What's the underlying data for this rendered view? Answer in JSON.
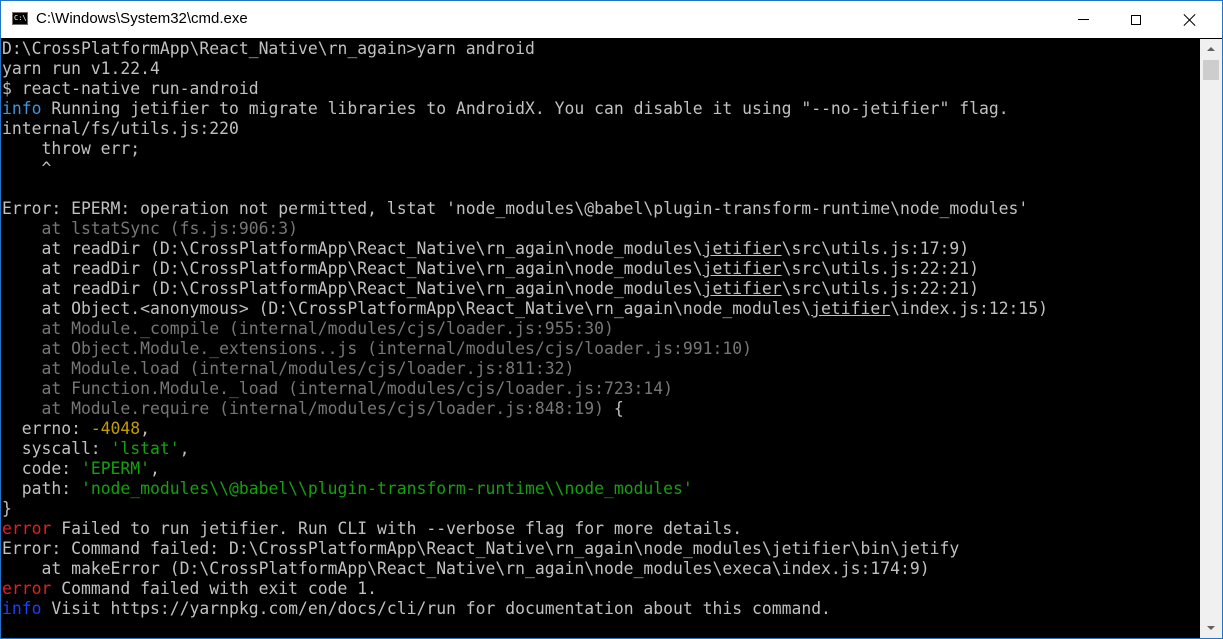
{
  "window": {
    "title": "C:\\Windows\\System32\\cmd.exe",
    "icon": "cmd-app-icon",
    "icon_text": "C:\\"
  },
  "controls": {
    "minimize": "minimize-icon",
    "maximize": "maximize-icon",
    "close": "close-icon"
  },
  "colors": {
    "background": "#000000",
    "default_text": "#c0c0c0",
    "dim_text": "#767676",
    "info": "#3a96dd",
    "error": "#e02020",
    "number": "#c19c00",
    "string": "#13a10e",
    "link_info": "#1a3fff"
  },
  "console": {
    "lines": [
      [
        {
          "t": "D:\\CrossPlatformApp\\React_Native\\rn_again>yarn android",
          "c": "w"
        }
      ],
      [
        {
          "t": "yarn run v1.22.4",
          "c": "w"
        }
      ],
      [
        {
          "t": "$ react-native run-android",
          "c": "w"
        }
      ],
      [
        {
          "t": "info",
          "c": "c"
        },
        {
          "t": " Running ",
          "c": "w"
        },
        {
          "t": "jetifier",
          "c": "w"
        },
        {
          "t": " to migrate libraries to AndroidX. You can disable it using \"--no-jetifier\" flag.",
          "c": "w"
        }
      ],
      [
        {
          "t": "internal/fs/utils.js:220",
          "c": "w"
        }
      ],
      [
        {
          "t": "    throw err;",
          "c": "w"
        }
      ],
      [
        {
          "t": "    ^",
          "c": "w"
        }
      ],
      [
        {
          "t": "",
          "c": "w"
        }
      ],
      [
        {
          "t": "Error: EPERM: operation not permitted, lstat 'node_modules\\@babel\\plugin-transform-runtime\\node_modules'",
          "c": "w"
        }
      ],
      [
        {
          "t": "    at lstatSync (fs.js:906:3)",
          "c": "d"
        }
      ],
      [
        {
          "t": "    at readDir (D:\\CrossPlatformApp\\React_Native\\rn_again\\node_modules\\",
          "c": "w"
        },
        {
          "t": "jetifier",
          "c": "w",
          "u": true
        },
        {
          "t": "\\src\\utils.js:17:9)",
          "c": "w"
        }
      ],
      [
        {
          "t": "    at readDir (D:\\CrossPlatformApp\\React_Native\\rn_again\\node_modules\\",
          "c": "w"
        },
        {
          "t": "jetifier",
          "c": "w",
          "u": true
        },
        {
          "t": "\\src\\utils.js:22:21)",
          "c": "w"
        }
      ],
      [
        {
          "t": "    at readDir (D:\\CrossPlatformApp\\React_Native\\rn_again\\node_modules\\",
          "c": "w"
        },
        {
          "t": "jetifier",
          "c": "w",
          "u": true
        },
        {
          "t": "\\src\\utils.js:22:21)",
          "c": "w"
        }
      ],
      [
        {
          "t": "    at Object.<anonymous> (D:\\CrossPlatformApp\\React_Native\\rn_again\\node_modules\\",
          "c": "w"
        },
        {
          "t": "jetifier",
          "c": "w",
          "u": true
        },
        {
          "t": "\\index.js:12:15)",
          "c": "w"
        }
      ],
      [
        {
          "t": "    at Module._compile (internal/modules/cjs/loader.js:955:30)",
          "c": "d"
        }
      ],
      [
        {
          "t": "    at Object.Module._extensions..js (internal/modules/cjs/loader.js:991:10)",
          "c": "d"
        }
      ],
      [
        {
          "t": "    at Module.load (internal/modules/cjs/loader.js:811:32)",
          "c": "d"
        }
      ],
      [
        {
          "t": "    at Function.Module._load (internal/modules/cjs/loader.js:723:14)",
          "c": "d"
        }
      ],
      [
        {
          "t": "    at Module.require (internal/modules/cjs/loader.js:848:19)",
          "c": "d"
        },
        {
          "t": " {",
          "c": "w"
        }
      ],
      [
        {
          "t": "  errno: ",
          "c": "w"
        },
        {
          "t": "-4048",
          "c": "y"
        },
        {
          "t": ",",
          "c": "w"
        }
      ],
      [
        {
          "t": "  syscall: ",
          "c": "w"
        },
        {
          "t": "'lstat'",
          "c": "g"
        },
        {
          "t": ",",
          "c": "w"
        }
      ],
      [
        {
          "t": "  code: ",
          "c": "w"
        },
        {
          "t": "'EPERM'",
          "c": "g"
        },
        {
          "t": ",",
          "c": "w"
        }
      ],
      [
        {
          "t": "  path: ",
          "c": "w"
        },
        {
          "t": "'node_modules\\\\@babel\\\\plugin-transform-runtime\\\\node_modules'",
          "c": "g"
        }
      ],
      [
        {
          "t": "}",
          "c": "w"
        }
      ],
      [
        {
          "t": "error",
          "c": "r"
        },
        {
          "t": " Failed to run jetifier. Run CLI with --verbose flag for more details.",
          "c": "w"
        }
      ],
      [
        {
          "t": "Error: Command failed: D:\\CrossPlatformApp\\React_Native\\rn_again\\node_modules\\jetifier\\bin\\jetify",
          "c": "w"
        }
      ],
      [
        {
          "t": "    at makeError (D:\\CrossPlatformApp\\React_Native\\rn_again\\node_modules\\execa\\index.js:174:9)",
          "c": "w"
        }
      ],
      [
        {
          "t": "error",
          "c": "r"
        },
        {
          "t": " Command failed with exit code 1.",
          "c": "w"
        }
      ],
      [
        {
          "t": "info",
          "c": "b"
        },
        {
          "t": " Visit https://yarnpkg.com/en/docs/cli/run for documentation about this command.",
          "c": "w"
        }
      ]
    ]
  },
  "scrollbar": {
    "up": "scroll-up-arrow-icon",
    "down": "scroll-down-arrow-icon"
  }
}
